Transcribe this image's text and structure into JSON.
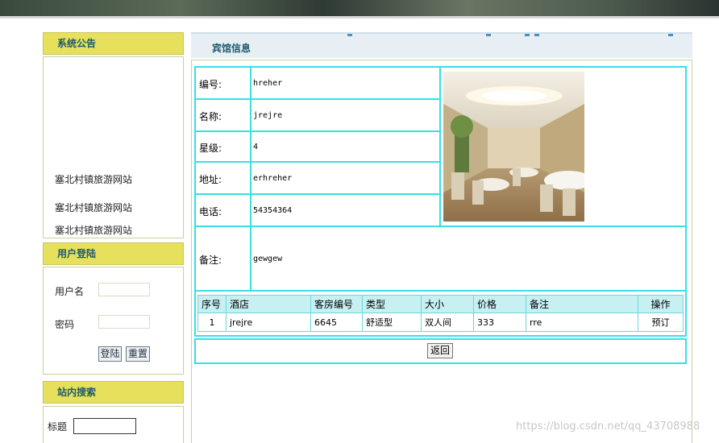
{
  "sidebar": {
    "announcement_title": "系统公告",
    "announcements": [
      "塞北村镇旅游网站",
      "塞北村镇旅游网站",
      "塞北村镇旅游网站"
    ],
    "login_title": "用户登陆",
    "username_label": "用户名",
    "password_label": "密码",
    "login_button": "登陆",
    "reset_button": "重置",
    "search_title": "站内搜索",
    "search_label": "标题"
  },
  "main": {
    "title": "宾馆信息",
    "fields": [
      {
        "label": "编号:",
        "value": "hreher"
      },
      {
        "label": "名称:",
        "value": "jrejre"
      },
      {
        "label": "星级:",
        "value": "4"
      },
      {
        "label": "地址:",
        "value": "erhreher"
      },
      {
        "label": "电话:",
        "value": "54354364"
      },
      {
        "label": "备注:",
        "value": "gewgew"
      }
    ],
    "rooms_table": {
      "headers": [
        "序号",
        "酒店",
        "客房编号",
        "类型",
        "大小",
        "价格",
        "备注",
        "操作"
      ],
      "rows": [
        [
          "1",
          "jrejre",
          "6645",
          "舒适型",
          "双人间",
          "333",
          "rre",
          "预订"
        ]
      ]
    },
    "back_button": "返回"
  },
  "watermark": "https://blog.csdn.net/qq_43708988",
  "colors": {
    "accent_header": "#e6e05c",
    "cell_border": "#36e0e6",
    "title_text": "#1f5a6a"
  }
}
